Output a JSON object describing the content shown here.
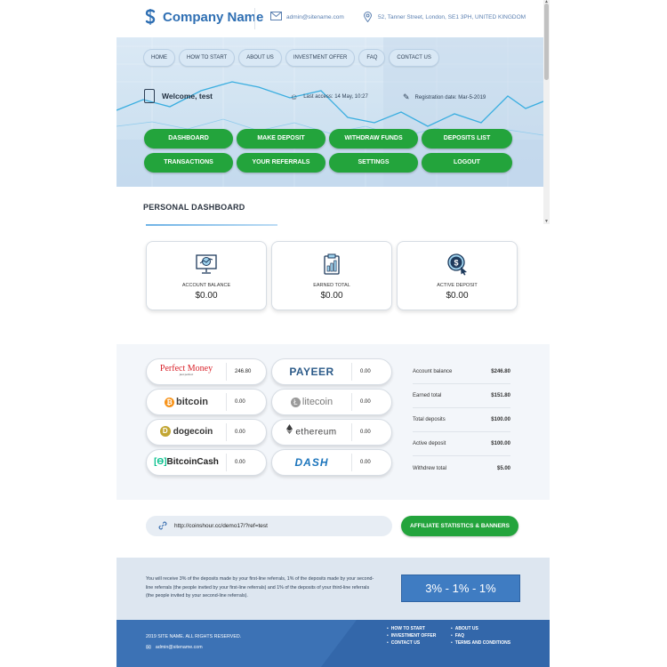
{
  "header": {
    "company_name": "Company Name",
    "email": "admin@sitename.com",
    "address": "52, Tanner Street, London, SE1 3PH, UNITED KINGDOM"
  },
  "nav": [
    "HOME",
    "HOW TO START",
    "ABOUT US",
    "INVESTMENT OFFER",
    "FAQ",
    "CONTACT US"
  ],
  "user": {
    "welcome": "Welcome, test",
    "last_access": "Last access: 14 May, 10:27",
    "registration": "Registration date: Mar-5-2019"
  },
  "menu": [
    "DASHBOARD",
    "MAKE DEPOSIT",
    "WITHDRAW FUNDS",
    "DEPOSITS LIST",
    "TRANSACTIONS",
    "YOUR REFERRALS",
    "SETTINGS",
    "LOGOUT"
  ],
  "dashboard": {
    "title": "PERSONAL DASHBOARD",
    "cards": [
      {
        "label": "ACCOUNT BALANCE",
        "value": "$0.00",
        "icon": "monitor-chart-icon"
      },
      {
        "label": "EARNED TOTAL",
        "value": "$0.00",
        "icon": "clipboard-chart-icon"
      },
      {
        "label": "ACTIVE DEPOSIT",
        "value": "$0.00",
        "icon": "dollar-coin-cursor-icon"
      }
    ]
  },
  "payment_systems": [
    {
      "name": "Perfect Money",
      "tagline": "just perfect",
      "amount": "246.80",
      "color": "#d9222a"
    },
    {
      "name": "PAYEER",
      "amount": "0.00",
      "color": "#2e5c8a"
    },
    {
      "name": "bitcoin",
      "amount": "0.00",
      "color": "#f7931a"
    },
    {
      "name": "litecoin",
      "amount": "0.00",
      "color": "#8a8a8a"
    },
    {
      "name": "dogecoin",
      "amount": "0.00",
      "color": "#c2a633"
    },
    {
      "name": "ethereum",
      "amount": "0.00",
      "color": "#3c3c3d"
    },
    {
      "name": "BitcoinCash",
      "amount": "0.00",
      "color": "#0ac18e"
    },
    {
      "name": "DASH",
      "amount": "0.00",
      "color": "#1c75bc"
    }
  ],
  "stats": [
    {
      "label": "Account balance",
      "value": "$246.80"
    },
    {
      "label": "Earned total",
      "value": "$151.80"
    },
    {
      "label": "Total deposits",
      "value": "$100.00"
    },
    {
      "label": "Active deposit",
      "value": "$100.00"
    },
    {
      "label": "Withdrew total",
      "value": "$5.00"
    }
  ],
  "referral": {
    "link": "http://coinshour.cc/demo17/?ref=test",
    "button": "AFFILIATE STATISTICS & BANNERS",
    "description": "You will receive 3% of the deposits made by your first-line referrals, 1% of the deposits made by your second-line referrals (the people invited by your first-line referrals) and 1% of the deposits of your third-line referrals (the people invited by your second-line referrals).",
    "rates": "3% - 1% - 1%"
  },
  "footer": {
    "copyright": "2019 SITE NAME. ALL RIGHTS RESERVED.",
    "email": "admin@sitename.com",
    "links_col1": [
      "HOW TO START",
      "INVESTMENT OFFER",
      "CONTACT US"
    ],
    "links_col2": [
      "ABOUT US",
      "FAQ",
      "TERMS AND CONDITIONS"
    ]
  },
  "colors": {
    "brand": "#2f6fb3",
    "accent_green": "#23a43c",
    "footer": "#3c72b5"
  }
}
